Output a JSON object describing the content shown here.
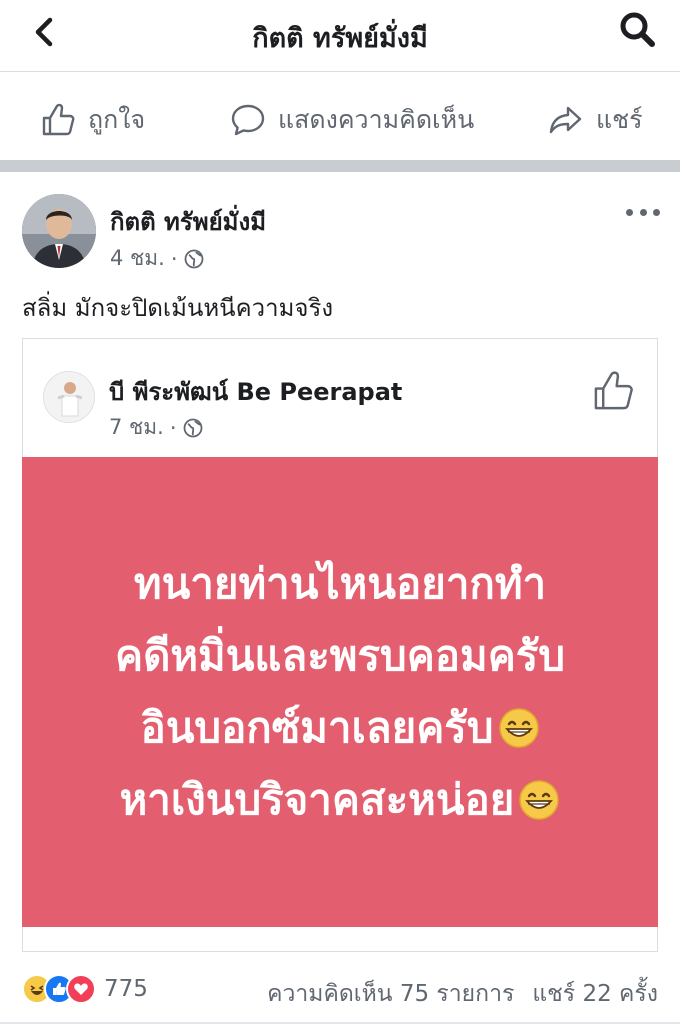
{
  "header": {
    "title": "กิตติ ทรัพย์มั่งมี",
    "back_icon": "chevron-left-icon",
    "search_icon": "search-icon"
  },
  "actions": {
    "like": "ถูกใจ",
    "comment": "แสดงความคิดเห็น",
    "share": "แชร์"
  },
  "post": {
    "author": "กิตติ ทรัพย์มั่งมี",
    "time": "4 ชม.",
    "dot": "·",
    "text": "สลิ่ม มักจะปิดเม้นหนีความจริง"
  },
  "shared": {
    "author": "บี พีระพัฒน์ Be Peerapat",
    "time": "7 ชม.",
    "dot": "·",
    "banner_bg": "#e35f6f",
    "lines": [
      "ทนายท่านไหนอยากทำ",
      "คดีหมิ่นและพรบคอมครับ",
      "อินบอกซ์มาเลยครับ",
      "หาเงินบริจาคสะหน่อย"
    ]
  },
  "footer": {
    "reaction_count": "775",
    "comments": "ความคิดเห็น 75 รายการ",
    "shares": "แชร์ 22 ครั้ง"
  }
}
